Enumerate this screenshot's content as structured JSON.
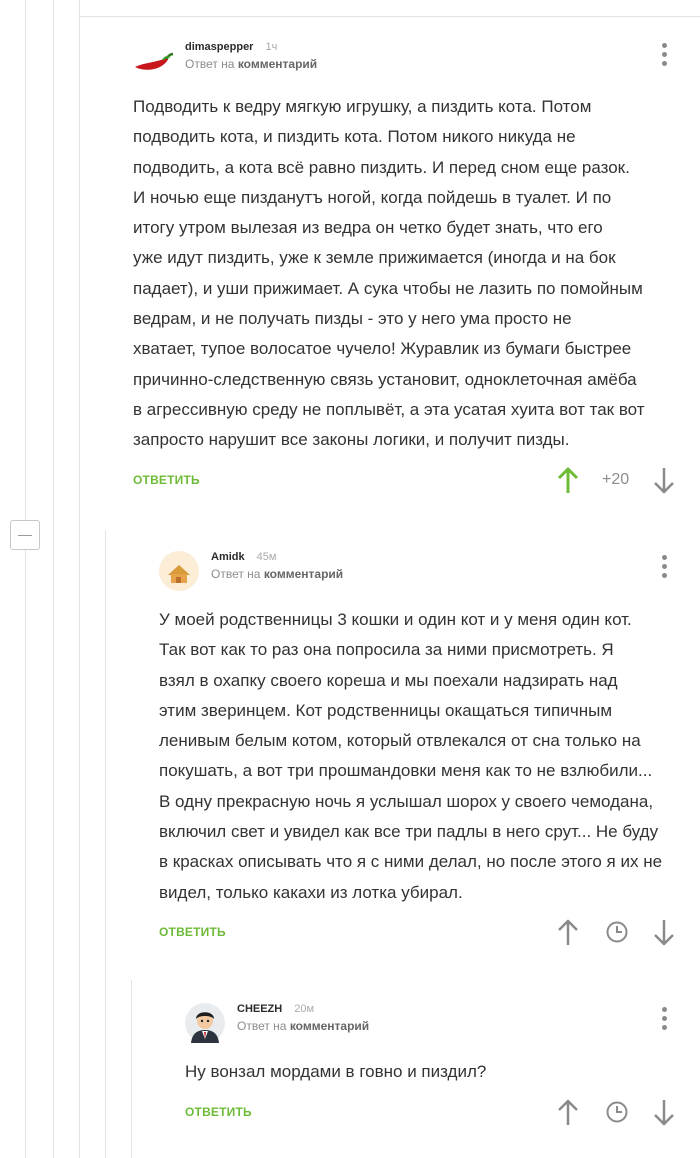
{
  "comments": [
    {
      "author": "dimaspepper",
      "time": "1ч",
      "reply_prefix": "Ответ на",
      "reply_target": "комментарий",
      "lines": [
        "Подводить к ведру мягкую игрушку, а пиздить кота. Потом",
        "подводить кота, и пиздить кота. Потом никого никуда не",
        "подводить, а кота всё равно пиздить. И перед сном еще разок.",
        "И ночью еще пизданутъ ногой, когда пойдешь в туалет. И по",
        "итогу утром вылезая из ведра он четко будет знать, что его",
        "уже идут пиздить, уже к земле прижимается (иногда и на бок",
        "падает), и уши прижимает. А сука чтобы не лазить по помойным",
        "ведрам, и не получать пизды - это у него ума просто не",
        "хватает, тупое волосатое чучело! Журавлик из бумаги быстрее",
        "причинно-следственную связь установит, одноклеточная амёба",
        "в агрессивную среду не поплывёт, а эта усатая хуита вот так вот",
        "запросто нарушит все законы логики, и получит пизды."
      ],
      "reply_label": "ОТВЕТИТЬ",
      "score": "+20",
      "avatar_icon": "chili-pepper-avatar",
      "upvote_color": "#6dbb36"
    },
    {
      "author": "Amidk",
      "time": "45м",
      "reply_prefix": "Ответ на",
      "reply_target": "комментарий",
      "lines": [
        "У моей родственницы 3 кошки и один кот и у меня один кот.",
        "Так вот как то раз она попросила за ними присмотреть. Я",
        "взял в охапку своего кореша и мы поехали надзирать над",
        "этим зверинцем. Кот родственницы окащаться типичным",
        "ленивым белым котом, который отвлекался от сна только на",
        "покушать, а вот три прошмандовки меня как то не взлюбили...",
        "В одну прекрасную ночь я услышал шорох у своего чемодана,",
        "включил свет и увидел как все три падлы в него срут... Не буду",
        "в красках описывать что я с ними делал, но после этого я их не",
        "видел, только какахи из лотка убирал."
      ],
      "reply_label": "ОТВЕТИТЬ",
      "avatar_icon": "house-avatar"
    },
    {
      "author": "CHEEZH",
      "time": "20м",
      "reply_prefix": "Ответ на",
      "reply_target": "комментарий",
      "lines": [
        "Ну вонзал мордами в говно и пиздил?"
      ],
      "reply_label": "ОТВЕТИТЬ",
      "avatar_icon": "cartoon-man-avatar"
    }
  ]
}
